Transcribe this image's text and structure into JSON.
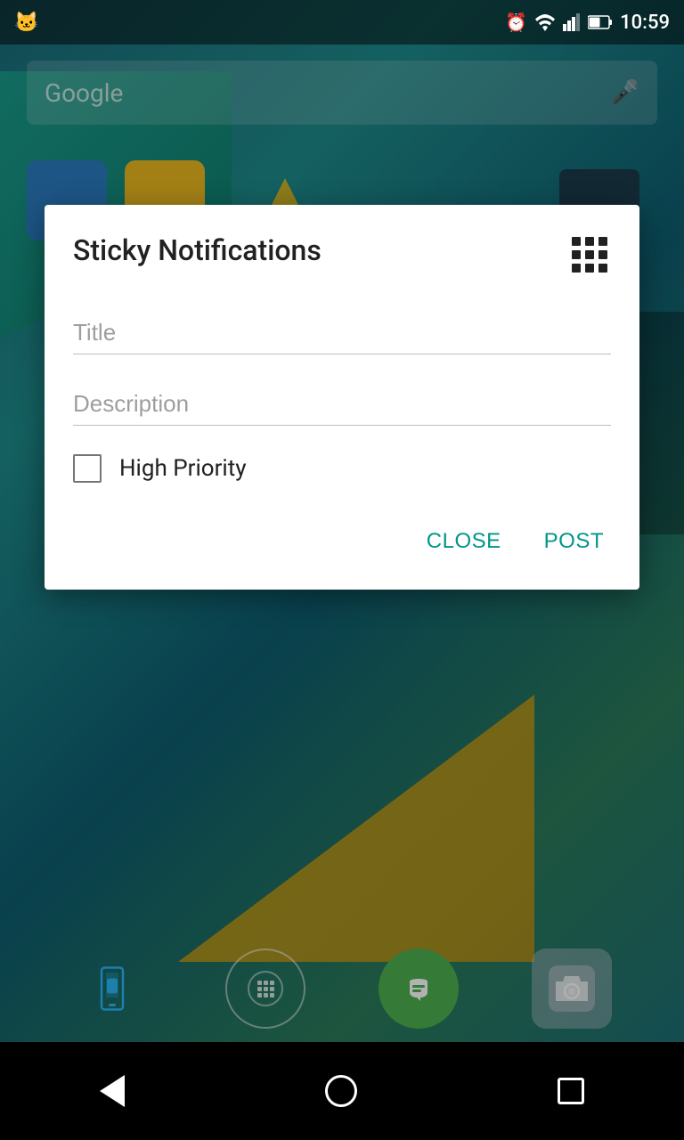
{
  "statusBar": {
    "time": "10:59",
    "catIcon": "🐱"
  },
  "googleBar": {
    "text": "Google",
    "micIcon": "🎤"
  },
  "dialog": {
    "title": "Sticky Notifications",
    "gridIconLabel": "grid-icon",
    "titleInput": {
      "placeholder": "Title",
      "value": ""
    },
    "descriptionInput": {
      "placeholder": "Description",
      "value": ""
    },
    "checkbox": {
      "label": "High Priority",
      "checked": false
    },
    "closeButton": "CLOSE",
    "postButton": "POST"
  },
  "navBar": {
    "backLabel": "back",
    "homeLabel": "home",
    "recentsLabel": "recents"
  }
}
